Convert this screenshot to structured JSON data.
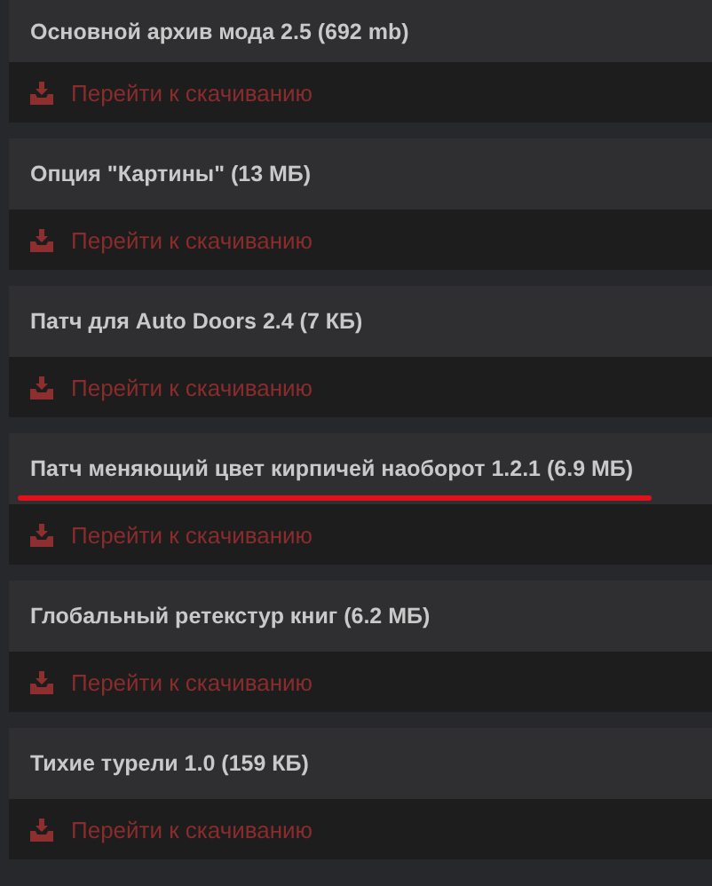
{
  "files": [
    {
      "title": "Основной архив мода 2.5 (692 mb)",
      "link": "Перейти к скачиванию",
      "underlined": false
    },
    {
      "title": "Опция \"Картины\" (13 МБ)",
      "link": "Перейти к скачиванию",
      "underlined": false
    },
    {
      "title": "Патч для Auto Doors 2.4 (7 КБ)",
      "link": "Перейти к скачиванию",
      "underlined": false
    },
    {
      "title": "Патч меняющий цвет кирпичей наоборот 1.2.1 (6.9 МБ)",
      "link": "Перейти к скачиванию",
      "underlined": true
    },
    {
      "title": "Глобальный ретекстур книг (6.2 МБ)",
      "link": "Перейти к скачиванию",
      "underlined": false
    },
    {
      "title": "Тихие турели 1.0 (159 КБ)",
      "link": "Перейти к скачиванию",
      "underlined": false
    }
  ]
}
